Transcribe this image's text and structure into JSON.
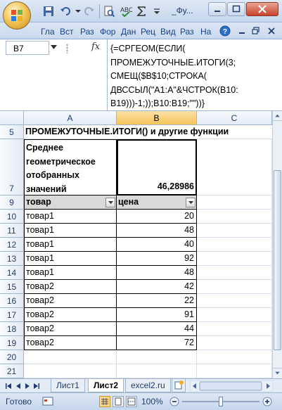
{
  "window": {
    "doc_title": "_Фу...",
    "office_button": "office-button"
  },
  "ribbon": {
    "tabs": [
      "Гла",
      "Вст",
      "Раз",
      "Фор",
      "Дан",
      "Рец",
      "Вид",
      "Раз",
      "На"
    ]
  },
  "formula_bar": {
    "name_box": "B7",
    "fx": "fx",
    "formula": "{=СРГЕОМ(ЕСЛИ(\nПРОМЕЖУТОЧНЫЕ.ИТОГИ(3;\nСМЕЩ($B$10;СТРОКА(\nДВССЫЛ(\"A1:A\"&ЧСТРОК(B10:\nB19)))-1;));B10:B19;\"\"))}"
  },
  "grid": {
    "columns": [
      "A",
      "B",
      "C"
    ],
    "selected_column": "B",
    "row5": {
      "num": "5",
      "text": "ПРОМЕЖУТОЧНЫЕ.ИТОГИ() и другие функции"
    },
    "row7": {
      "num": "7",
      "label": "Среднее\nгеометрическое\nотобранных\nзначений",
      "value": "46,28986"
    },
    "header": {
      "num": "9",
      "col_a": "товар",
      "col_b": "цена"
    },
    "rows": [
      {
        "num": "10",
        "item": "товар1",
        "price": "20"
      },
      {
        "num": "11",
        "item": "товар1",
        "price": "48"
      },
      {
        "num": "12",
        "item": "товар1",
        "price": "40"
      },
      {
        "num": "13",
        "item": "товар1",
        "price": "92"
      },
      {
        "num": "14",
        "item": "товар1",
        "price": "48"
      },
      {
        "num": "15",
        "item": "товар2",
        "price": "42"
      },
      {
        "num": "16",
        "item": "товар2",
        "price": "22"
      },
      {
        "num": "17",
        "item": "товар2",
        "price": "91"
      },
      {
        "num": "18",
        "item": "товар2",
        "price": "44"
      },
      {
        "num": "19",
        "item": "товар2",
        "price": "72"
      }
    ],
    "empty_rows": [
      "20",
      "21"
    ]
  },
  "sheets": {
    "tabs": [
      "Лист1",
      "Лист2",
      "excel2.ru"
    ],
    "active": "Лист2"
  },
  "status": {
    "text": "Готово",
    "zoom": "100%"
  },
  "colors": {
    "selection_header": "#f5c35a",
    "ribbon_text": "#15428b"
  }
}
